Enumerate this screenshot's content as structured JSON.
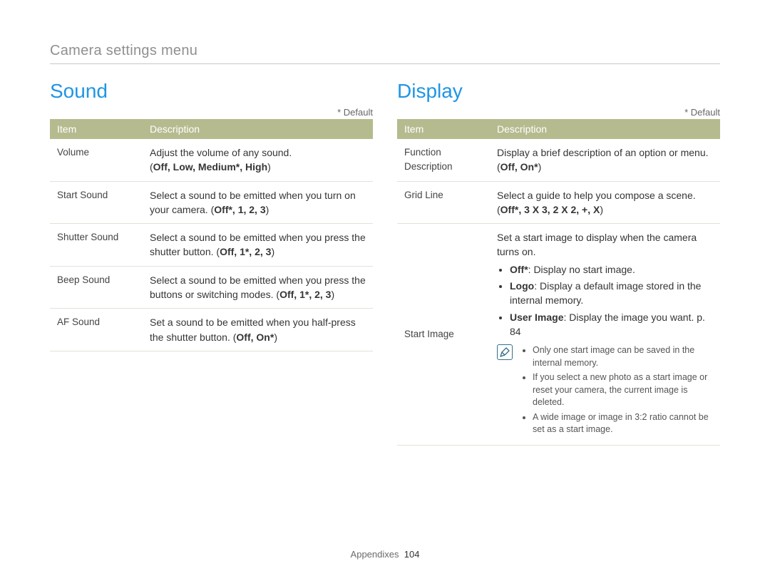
{
  "breadcrumb": "Camera settings menu",
  "default_note": "* Default",
  "footer": {
    "section": "Appendixes",
    "page": "104"
  },
  "headers": {
    "item": "Item",
    "description": "Description"
  },
  "sound": {
    "title": "Sound",
    "rows": [
      {
        "item": "Volume",
        "desc_pre": "Adjust the volume of any sound.",
        "desc_open": "(",
        "options": "Off, Low, Medium*, High",
        "desc_close": ")"
      },
      {
        "item": "Start Sound",
        "desc_pre": "Select a sound to be emitted when you turn on your camera. ",
        "desc_open": "(",
        "options": "Off*, 1, 2, 3",
        "desc_close": ")"
      },
      {
        "item": "Shutter Sound",
        "desc_pre": "Select a sound to be emitted when you press the shutter button. ",
        "desc_open": "(",
        "options": "Off, 1*, 2, 3",
        "desc_close": ")"
      },
      {
        "item": "Beep Sound",
        "desc_pre": "Select a sound to be emitted when you press the buttons or switching modes. ",
        "desc_open": "(",
        "options": "Off, 1*, 2, 3",
        "desc_close": ")"
      },
      {
        "item": "AF Sound",
        "desc_pre": "Set a sound to be emitted when you half-press the shutter button. ",
        "desc_open": "(",
        "options": "Off, On*",
        "desc_close": ")"
      }
    ]
  },
  "display": {
    "title": "Display",
    "rows": [
      {
        "item": "Function Description",
        "desc_pre": "Display a brief description of an option or menu.",
        "desc_open": "(",
        "options": "Off, On*",
        "desc_close": ")"
      },
      {
        "item": "Grid Line",
        "desc_pre": "Select a guide to help you compose a scene.",
        "desc_open": "(",
        "options": "Off*, 3 X 3, 2 X 2, +, X",
        "desc_close": ")"
      }
    ],
    "start_image": {
      "item": "Start Image",
      "intro": "Set a start image to display when the camera turns on.",
      "bullets": [
        {
          "label": "Off*",
          "text": ": Display no start image."
        },
        {
          "label": "Logo",
          "text": ": Display a default image stored in the internal memory."
        },
        {
          "label": "User Image",
          "text": ": Display the image you want. p. 84"
        }
      ],
      "note_icon_glyph": "✎",
      "notes": [
        "Only one start image can be saved in the internal memory.",
        "If you select a new photo as a start image or reset your camera, the current image is deleted.",
        "A wide image or image in 3:2 ratio cannot be set as a start image."
      ]
    }
  }
}
